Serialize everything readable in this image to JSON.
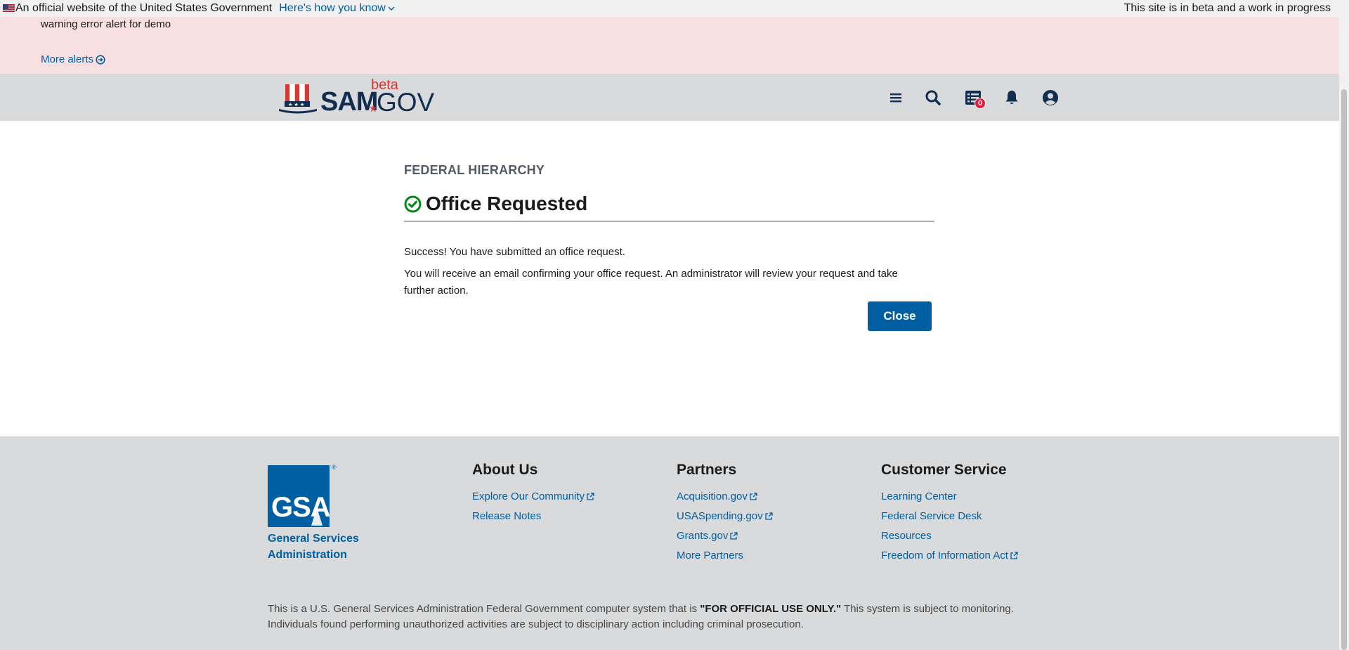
{
  "gov_banner": {
    "official_text": "An official website of the United States Government",
    "how_link": "Here's how you know",
    "beta_notice": "This site is in beta and a work in progress"
  },
  "alert": {
    "message": "warning error alert for demo",
    "more_link": "More alerts"
  },
  "header": {
    "logo": {
      "sam": "SAM",
      "gov": "GOV",
      "beta": "beta"
    },
    "icons": [
      "menu-icon",
      "search-icon",
      "workspace-icon",
      "notifications-icon",
      "user-icon"
    ],
    "workspace_badge": "0"
  },
  "main": {
    "eyebrow": "FEDERAL HIERARCHY",
    "title": "Office Requested",
    "success_line": "Success! You have submitted an office request.",
    "detail_line": "You will receive an email confirming your office request. An administrator will review your request and take further action.",
    "close_label": "Close"
  },
  "footer": {
    "gsa_logo_text": "GSA",
    "gsa_line1": "General Services",
    "gsa_line2": "Administration",
    "about": {
      "heading": "About Us",
      "links": [
        "Explore Our Community",
        "Release Notes"
      ]
    },
    "partners": {
      "heading": "Partners",
      "links": [
        "Acquisition.gov",
        "USASpending.gov",
        "Grants.gov",
        "More Partners"
      ]
    },
    "customer_service": {
      "heading": "Customer Service",
      "links": [
        "Learning Center",
        "Federal Service Desk",
        "Resources",
        "Freedom of Information Act"
      ]
    },
    "disclaimer_pre": "This is a U.S. General Services Administration Federal Government computer system that is ",
    "disclaimer_bold": "\"FOR OFFICIAL USE ONLY.\"",
    "disclaimer_post": " This system is subject to monitoring. Individuals found performing unauthorized activities are subject to disciplinary action including criminal prosecution."
  },
  "colors": {
    "primary": "#005ea2",
    "navy": "#112e51",
    "red": "#d83933",
    "success": "#00a91c",
    "alert_bg": "#f8dfe1",
    "header_bg": "#d9dadb"
  }
}
